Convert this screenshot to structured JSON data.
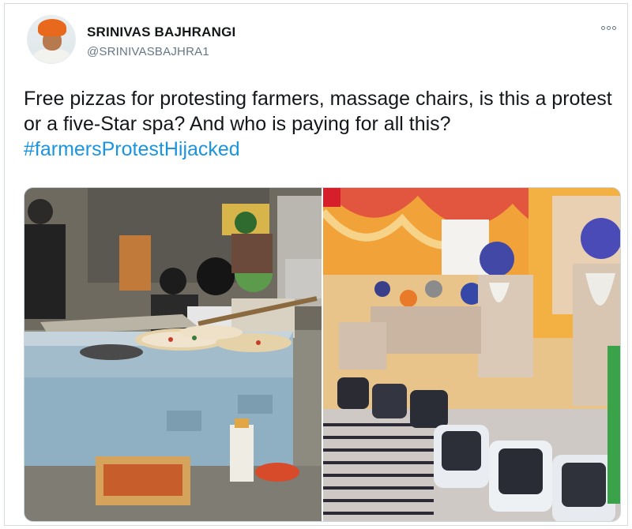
{
  "user": {
    "display_name": "SRINIVAS BAJHRANGI",
    "handle": "@SRINIVASBAJHRA1"
  },
  "tweet": {
    "text": "Free pizzas for protesting farmers, massage chairs, is this a protest or a five-Star spa? And who is paying for all this?",
    "hashtag": "#farmersProtestHijacked"
  },
  "icons": {
    "more": "more-options-icon"
  },
  "colors": {
    "hashtag": "#1b95e0",
    "handle": "#657786",
    "text": "#14171a"
  }
}
